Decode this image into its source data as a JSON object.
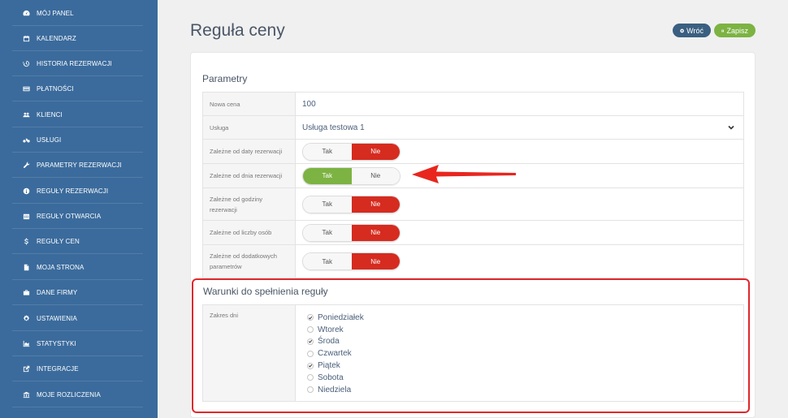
{
  "sidebar": {
    "items": [
      {
        "label": "MÓJ PANEL",
        "icon": "dashboard-icon"
      },
      {
        "label": "KALENDARZ",
        "icon": "calendar-icon"
      },
      {
        "label": "HISTORIA REZERWACJI",
        "icon": "history-icon"
      },
      {
        "label": "PŁATNOŚCI",
        "icon": "credit-card-icon"
      },
      {
        "label": "KLIENCI",
        "icon": "users-icon"
      },
      {
        "label": "USŁUGI",
        "icon": "bicycle-icon"
      },
      {
        "label": "PARAMETRY REZERWACJI",
        "icon": "wrench-icon"
      },
      {
        "label": "REGUŁY REZERWACJI",
        "icon": "info-circle-icon"
      },
      {
        "label": "REGUŁY OTWARCIA",
        "icon": "calendar-grid-icon"
      },
      {
        "label": "REGUŁY CEN",
        "icon": "dollar-icon"
      },
      {
        "label": "MOJA STRONA",
        "icon": "file-icon"
      },
      {
        "label": "DANE FIRMY",
        "icon": "briefcase-icon"
      },
      {
        "label": "USTAWIENIA",
        "icon": "gear-icon"
      },
      {
        "label": "STATYSTYKI",
        "icon": "area-chart-icon"
      },
      {
        "label": "INTEGRACJE",
        "icon": "external-link-icon"
      },
      {
        "label": "MOJE ROZLICZENIA",
        "icon": "bank-icon"
      }
    ]
  },
  "header": {
    "title": "Reguła ceny",
    "back_label": "Wróć",
    "save_label": "Zapisz"
  },
  "params": {
    "title": "Parametry",
    "new_price_label": "Nowa cena",
    "new_price_value": "100",
    "service_label": "Usługa",
    "service_value": "Usługa testowa 1",
    "toggles": [
      {
        "label": "Zależne od daty rezerwacji",
        "yes": "Tak",
        "no": "Nie",
        "selected": "Nie"
      },
      {
        "label": "Zależne od dnia rezerwacji",
        "yes": "Tak",
        "no": "Nie",
        "selected": "Tak"
      },
      {
        "label": "Zależne od godziny rezerwacji",
        "yes": "Tak",
        "no": "Nie",
        "selected": "Nie"
      },
      {
        "label": "Zależne od liczby osób",
        "yes": "Tak",
        "no": "Nie",
        "selected": "Nie"
      },
      {
        "label": "Zależne od dodatkowych parametrów",
        "yes": "Tak",
        "no": "Nie",
        "selected": "Nie"
      }
    ]
  },
  "conditions": {
    "title": "Warunki do spełnienia reguły",
    "days_label": "Zakres dni",
    "days": [
      {
        "label": "Poniedziałek",
        "checked": true
      },
      {
        "label": "Wtorek",
        "checked": false
      },
      {
        "label": "Środa",
        "checked": true
      },
      {
        "label": "Czwartek",
        "checked": false
      },
      {
        "label": "Piątek",
        "checked": true
      },
      {
        "label": "Sobota",
        "checked": false
      },
      {
        "label": "Niedziela",
        "checked": false
      }
    ]
  },
  "colors": {
    "sidebar": "#3b6b9c",
    "toggle_no": "#d62b1f",
    "toggle_yes": "#7cb342",
    "highlight": "#e0272b",
    "back_button": "#3a5f80",
    "save_button": "#7cb342"
  }
}
